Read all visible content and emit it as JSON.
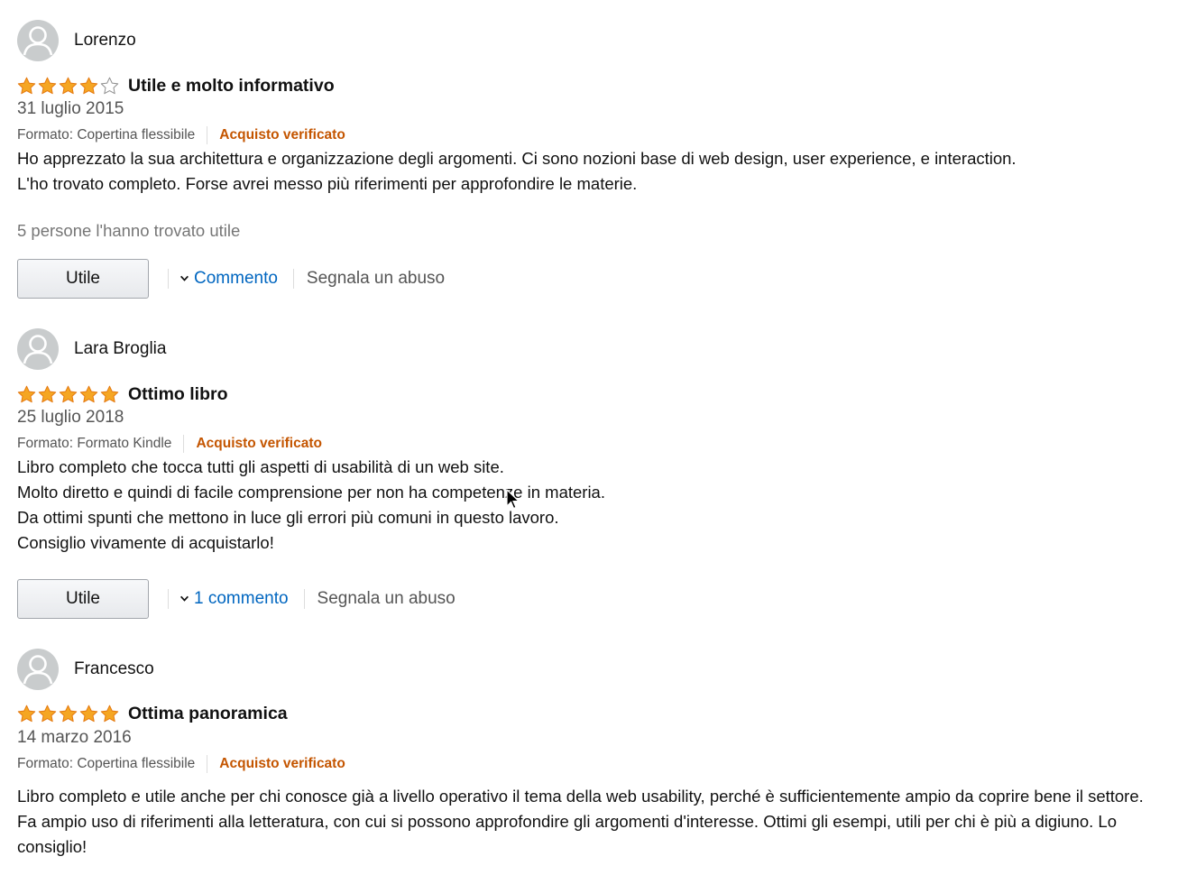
{
  "reviews": [
    {
      "name": "Lorenzo",
      "rating": 4,
      "title": "Utile e molto informativo",
      "date": "31 luglio 2015",
      "format": "Formato: Copertina flessibile",
      "verified": "Acquisto verificato",
      "body": [
        "Ho apprezzato la sua architettura e organizzazione degli argomenti. Ci sono nozioni base di web design, user experience, e interaction.",
        "L'ho trovato completo. Forse avrei messo più riferimenti per approfondire le materie."
      ],
      "helpful_count": "5 persone l'hanno trovato utile",
      "helpful_button": "Utile",
      "comment_link": "Commento",
      "report_link": "Segnala un abuso"
    },
    {
      "name": "Lara Broglia",
      "rating": 5,
      "title": "Ottimo libro",
      "date": "25 luglio 2018",
      "format": "Formato: Formato Kindle",
      "verified": "Acquisto verificato",
      "body": [
        "Libro completo che tocca tutti gli aspetti di usabilità di un web site.",
        "Molto diretto e quindi di facile comprensione per non ha competenze in materia.",
        "Da ottimi spunti che mettono in luce gli errori più comuni in questo lavoro.",
        "Consiglio vivamente di acquistarlo!"
      ],
      "helpful_button": "Utile",
      "comment_link": "1 commento",
      "report_link": "Segnala un abuso"
    },
    {
      "name": "Francesco",
      "rating": 5,
      "title": "Ottima panoramica",
      "date": "14 marzo 2016",
      "format": "Formato: Copertina flessibile",
      "verified": "Acquisto verificato",
      "body": [
        "Libro completo e utile anche per chi conosce già a livello operativo il tema della web usability, perché è sufficientemente ampio da coprire bene il settore. Fa ampio uso di riferimenti alla letteratura, con cui si possono approfondire gli argomenti d'interesse. Ottimi gli esempi, utili per chi è più a digiuno. Lo consiglio!"
      ]
    }
  ],
  "icons": {
    "star_full": "star-full-icon",
    "star_empty": "star-empty-icon",
    "avatar": "avatar-icon",
    "chevron": "chevron-down-icon"
  },
  "colors": {
    "star_fill": "#f5a623",
    "star_stroke": "#e47911",
    "verified": "#c45500",
    "link": "#0066c0",
    "muted": "#555555",
    "helpful_count": "#767676",
    "avatar_bg": "#c9cccd"
  }
}
